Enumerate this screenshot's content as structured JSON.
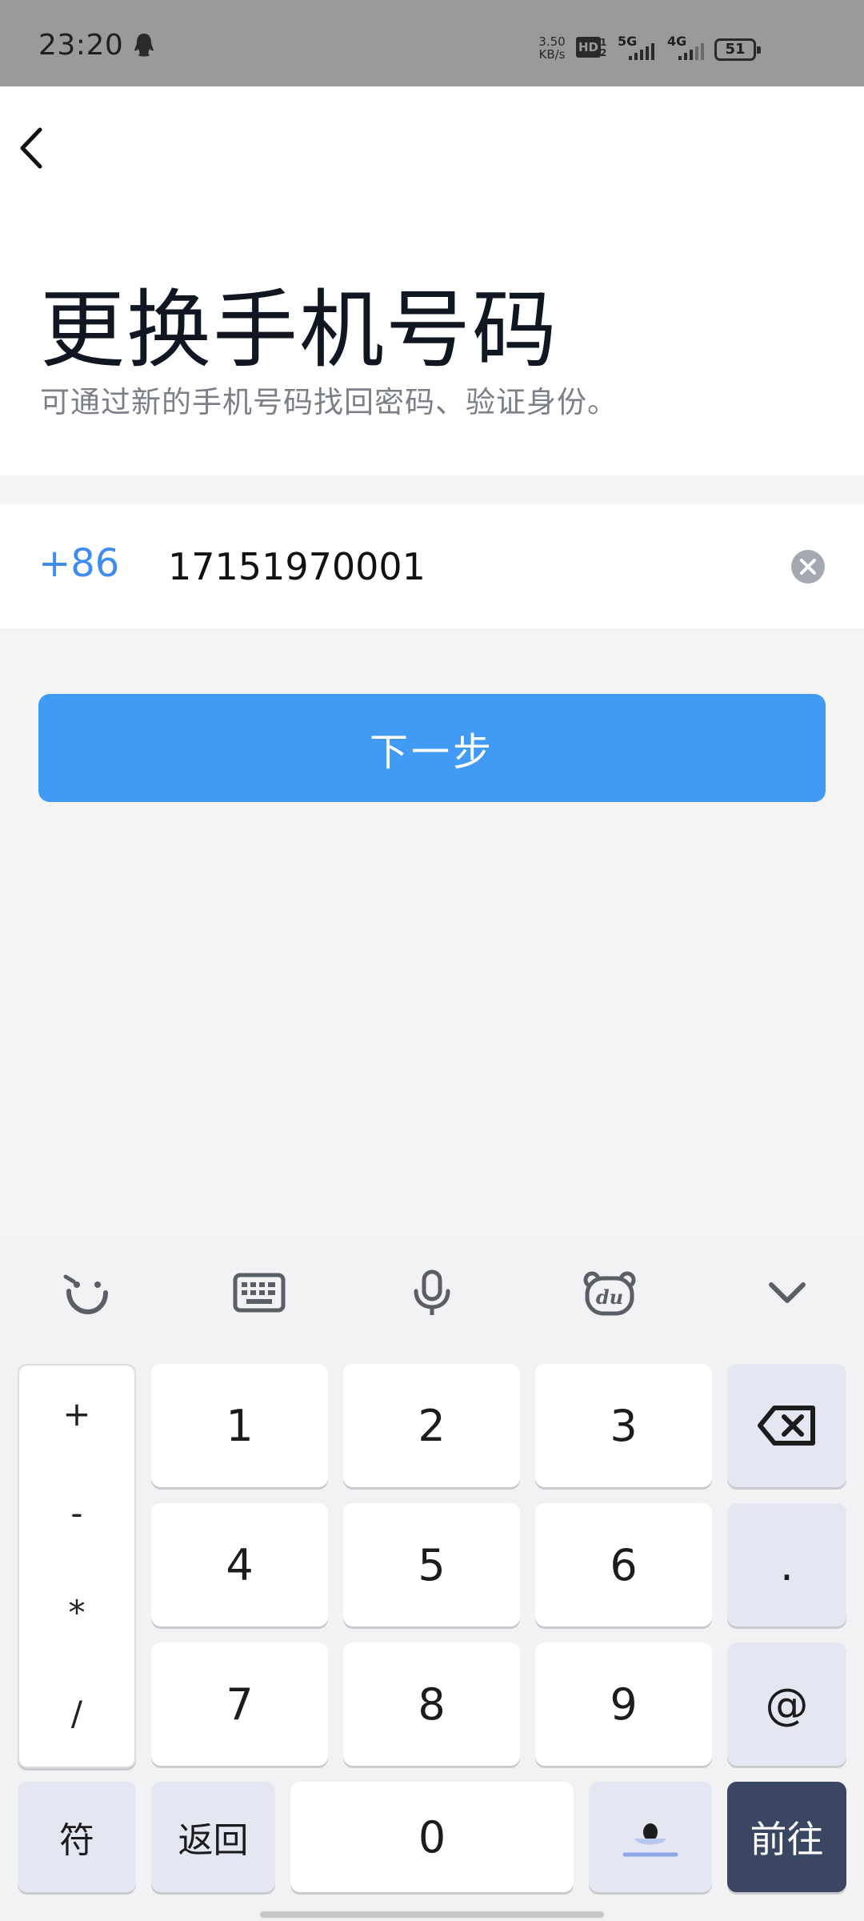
{
  "status_bar": {
    "time": "23:20",
    "speed_value": "3.50",
    "speed_unit": "KB/s",
    "hd_label": "HD",
    "net1": "5G",
    "net2": "4G",
    "battery": "51"
  },
  "header": {
    "title": "更换手机号码",
    "subtitle": "可通过新的手机号码找回密码、验证身份。"
  },
  "phone": {
    "country_code": "+86",
    "number": "17151970001"
  },
  "actions": {
    "next_label": "下一步"
  },
  "keyboard": {
    "symbols": [
      "+",
      "-",
      "*",
      "/"
    ],
    "digits": [
      "1",
      "2",
      "3",
      "4",
      "5",
      "6",
      "7",
      "8",
      "9",
      "0"
    ],
    "dot": ".",
    "at": "@",
    "symbol_key": "符",
    "return_key": "返回",
    "go_key": "前往"
  },
  "colors": {
    "accent": "#419bf5",
    "country_code": "#3f8cf0",
    "go_key": "#3b4662"
  }
}
